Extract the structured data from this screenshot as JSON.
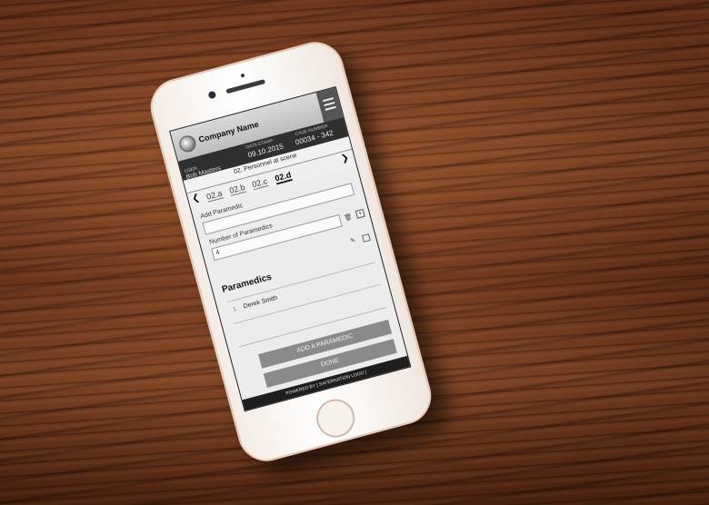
{
  "app": {
    "company_name": "Company Name",
    "menu_icon": "hamburger-icon"
  },
  "meta": {
    "user_label": "USER:",
    "user_name": "Bob Masters",
    "data_stamp_label": "DATA STAMP:",
    "data_stamp_value": "09.10.2015",
    "case_number_label": "CASE NUMBER:",
    "case_number_value": "00034 - 342"
  },
  "section": {
    "title": "02. Personnel at scene"
  },
  "tabs": [
    "02.a",
    "02.b",
    "02.c",
    "02.d"
  ],
  "form": {
    "add_paramedic_label": "Add Paramedic",
    "add_paramedic_value": "",
    "number_label": "Number of Paramedics",
    "number_value": "4"
  },
  "paramedics": {
    "heading": "Paramedics",
    "items": [
      {
        "index": "1",
        "name": "Derek Smith"
      }
    ]
  },
  "buttons": {
    "add": "ADD A PARAMEDIC",
    "done": "DONE"
  },
  "footer": {
    "text": "POWERED BY [ SAFERNATION LOGO ]"
  }
}
